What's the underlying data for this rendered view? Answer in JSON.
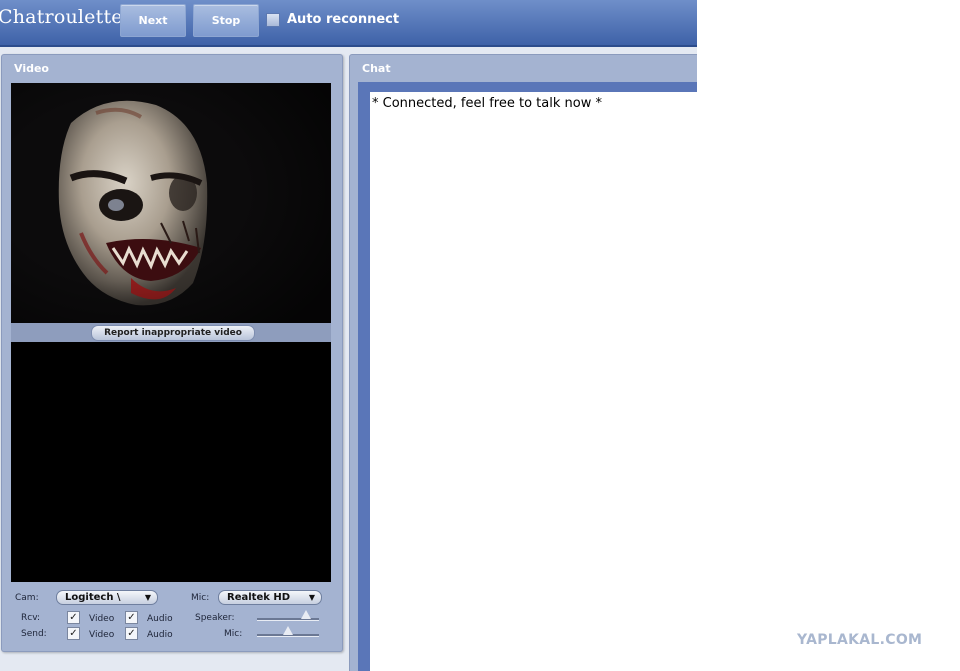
{
  "app": {
    "title": "Chatroulette"
  },
  "toolbar": {
    "next_label": "Next",
    "stop_label": "Stop",
    "auto_reconnect_label": "Auto reconnect",
    "auto_reconnect_checked": false
  },
  "video_panel": {
    "title": "Video",
    "report_label": "Report inappropriate video",
    "cam_label": "Cam:",
    "cam_value": "Logitech \\",
    "mic_label": "Mic:",
    "mic_value": "Realtek HD",
    "rcv_label": "Rcv:",
    "send_label": "Send:",
    "video_label": "Video",
    "audio_label": "Audio",
    "speaker_label": "Speaker:",
    "mic_slider_label": "Mic:",
    "rcv_video": true,
    "rcv_audio": true,
    "send_video": true,
    "send_audio": true,
    "speaker_level": 0.85,
    "mic_level": 0.5
  },
  "chat_panel": {
    "title": "Chat",
    "messages": [
      "* Connected, feel free to talk now *"
    ]
  },
  "watermark": "YAPLAKAL.COM",
  "colors": {
    "topbar": "#4a6db0",
    "panel": "#a4b3d1",
    "chat_frame": "#5a76b8"
  }
}
